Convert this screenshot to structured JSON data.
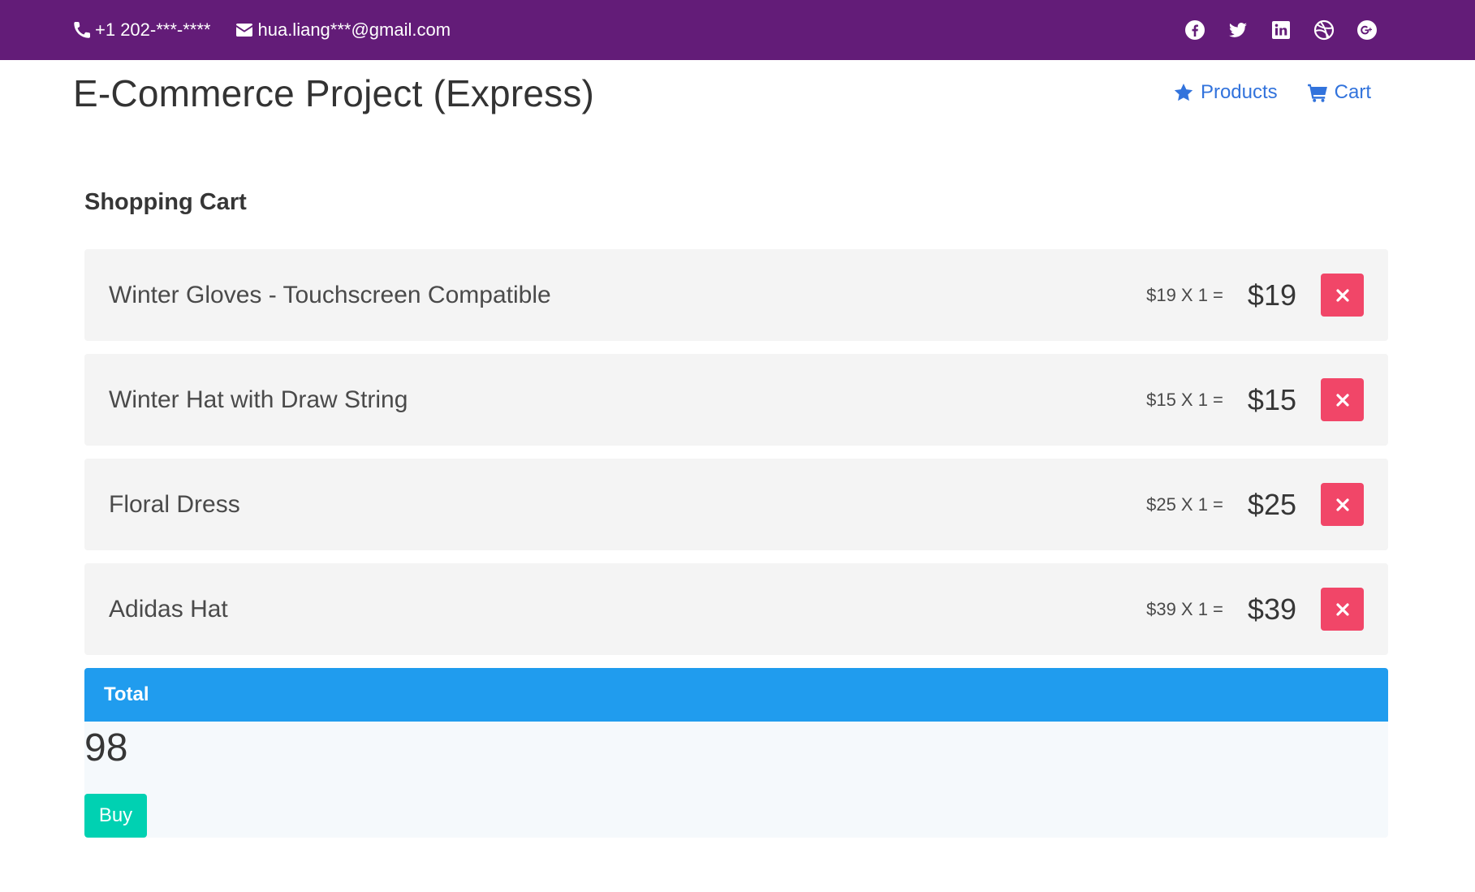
{
  "topbar": {
    "phone": "+1 202-***-****",
    "email": "hua.liang***@gmail.com",
    "social_icons": [
      "facebook-icon",
      "twitter-icon",
      "linkedin-icon",
      "dribbble-icon",
      "google-plus-icon"
    ]
  },
  "header": {
    "brand": "E-Commerce Project (Express)",
    "nav": [
      {
        "label": "Products",
        "icon": "star-icon"
      },
      {
        "label": "Cart",
        "icon": "shopping-cart-icon"
      }
    ]
  },
  "cart": {
    "title": "Shopping Cart",
    "items": [
      {
        "name": "Winter Gloves - Touchscreen Compatible",
        "calc": "$19 X 1 =",
        "price": "$19"
      },
      {
        "name": "Winter Hat with Draw String",
        "calc": "$15 X 1 =",
        "price": "$15"
      },
      {
        "name": "Floral Dress",
        "calc": "$25 X 1 =",
        "price": "$25"
      },
      {
        "name": "Adidas Hat",
        "calc": "$39 X 1 =",
        "price": "$39"
      }
    ],
    "total_label": "Total",
    "total_value": "98",
    "buy_label": "Buy"
  },
  "colors": {
    "topbar": "#631c78",
    "link": "#3273dc",
    "danger": "#f14668",
    "info": "#209cee",
    "primary": "#00d1b2"
  }
}
